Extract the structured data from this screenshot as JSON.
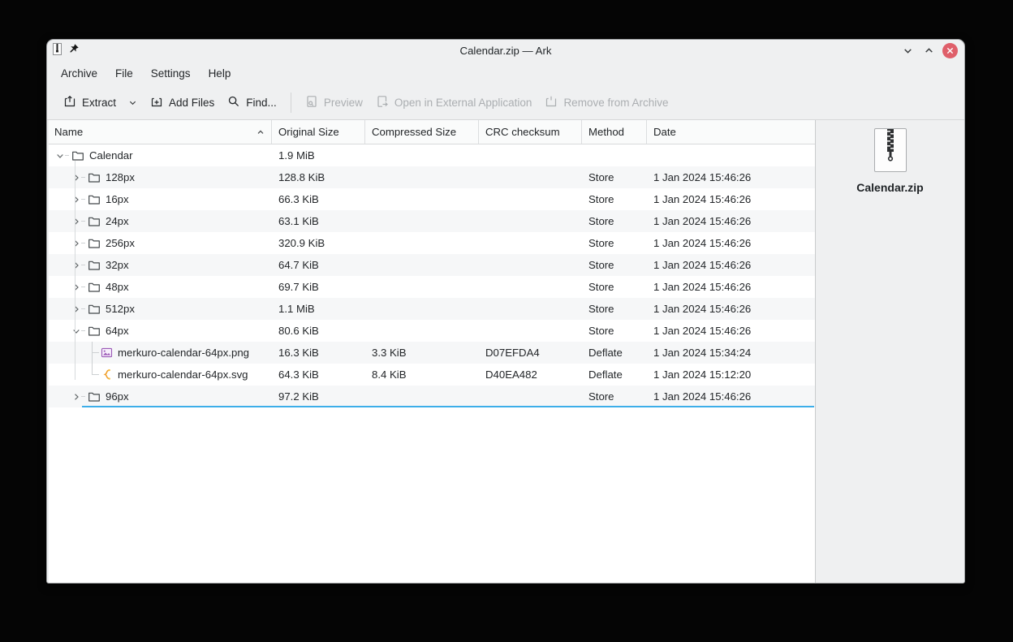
{
  "window": {
    "title": "Calendar.zip — Ark"
  },
  "menubar": {
    "items": [
      "Archive",
      "File",
      "Settings",
      "Help"
    ]
  },
  "toolbar": {
    "extract": "Extract",
    "add_files": "Add Files",
    "find": "Find...",
    "preview": "Preview",
    "open_external": "Open in External Application",
    "remove_from_archive": "Remove from Archive"
  },
  "table": {
    "columns": [
      "Name",
      "Original Size",
      "Compressed Size",
      "CRC checksum",
      "Method",
      "Date"
    ],
    "sort": {
      "column": "Name",
      "direction": "ascending"
    },
    "rows": [
      {
        "name": "Calendar",
        "level": 0,
        "icon": "folder",
        "expander": "expanded",
        "original": "1.9 MiB",
        "compressed": "",
        "crc": "",
        "method": "",
        "date": ""
      },
      {
        "name": "128px",
        "level": 1,
        "icon": "folder",
        "expander": "collapsed",
        "original": "128.8 KiB",
        "compressed": "",
        "crc": "",
        "method": "Store",
        "date": "1 Jan 2024 15:46:26"
      },
      {
        "name": "16px",
        "level": 1,
        "icon": "folder",
        "expander": "collapsed",
        "original": "66.3 KiB",
        "compressed": "",
        "crc": "",
        "method": "Store",
        "date": "1 Jan 2024 15:46:26"
      },
      {
        "name": "24px",
        "level": 1,
        "icon": "folder",
        "expander": "collapsed",
        "original": "63.1 KiB",
        "compressed": "",
        "crc": "",
        "method": "Store",
        "date": "1 Jan 2024 15:46:26"
      },
      {
        "name": "256px",
        "level": 1,
        "icon": "folder",
        "expander": "collapsed",
        "original": "320.9 KiB",
        "compressed": "",
        "crc": "",
        "method": "Store",
        "date": "1 Jan 2024 15:46:26"
      },
      {
        "name": "32px",
        "level": 1,
        "icon": "folder",
        "expander": "collapsed",
        "original": "64.7 KiB",
        "compressed": "",
        "crc": "",
        "method": "Store",
        "date": "1 Jan 2024 15:46:26"
      },
      {
        "name": "48px",
        "level": 1,
        "icon": "folder",
        "expander": "collapsed",
        "original": "69.7 KiB",
        "compressed": "",
        "crc": "",
        "method": "Store",
        "date": "1 Jan 2024 15:46:26"
      },
      {
        "name": "512px",
        "level": 1,
        "icon": "folder",
        "expander": "collapsed",
        "original": "1.1 MiB",
        "compressed": "",
        "crc": "",
        "method": "Store",
        "date": "1 Jan 2024 15:46:26"
      },
      {
        "name": "64px",
        "level": 1,
        "icon": "folder",
        "expander": "expanded",
        "original": "80.6 KiB",
        "compressed": "",
        "crc": "",
        "method": "Store",
        "date": "1 Jan 2024 15:46:26"
      },
      {
        "name": "merkuro-calendar-64px.png",
        "level": 2,
        "icon": "image",
        "expander": "none",
        "connector": "tee",
        "original": "16.3 KiB",
        "compressed": "3.3 KiB",
        "crc": "D07EFDA4",
        "method": "Deflate",
        "date": "1 Jan 2024 15:34:24"
      },
      {
        "name": "merkuro-calendar-64px.svg",
        "level": 2,
        "icon": "svgfile",
        "expander": "none",
        "connector": "corner",
        "original": "64.3 KiB",
        "compressed": "8.4 KiB",
        "crc": "D40EA482",
        "method": "Deflate",
        "date": "1 Jan 2024 15:12:20"
      },
      {
        "name": "96px",
        "level": 1,
        "icon": "folder",
        "expander": "collapsed",
        "original": "97.2 KiB",
        "compressed": "",
        "crc": "",
        "method": "Store",
        "date": "1 Jan 2024 15:46:26"
      }
    ]
  },
  "info_panel": {
    "file_name": "Calendar.zip"
  },
  "colors": {
    "accent": "#3daee9",
    "close_button": "#df5f6a",
    "window_bg": "#eff0f1",
    "view_bg": "#ffffff",
    "stripe": "#f6f7f8",
    "png_icon_color": "#9b59b6",
    "svg_icon_color": "#f0a02c"
  }
}
